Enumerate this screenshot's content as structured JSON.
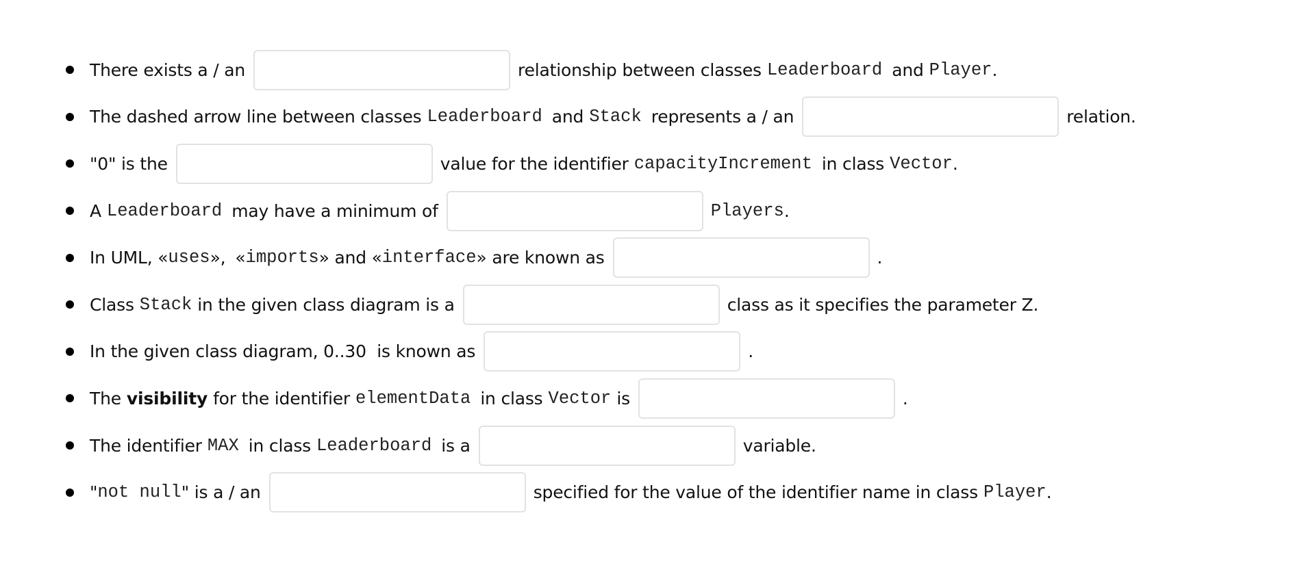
{
  "questions": [
    {
      "parts": {
        "t0": "There exists a / an",
        "t1": "relationship between classes",
        "c1": "Leaderboard",
        "t2": "and",
        "c2": "Player",
        "t3": "."
      },
      "blank": {
        "value": "",
        "placeholder": ""
      }
    },
    {
      "parts": {
        "t0": "The dashed arrow line between classes",
        "c1": "Leaderboard",
        "t1": "and",
        "c2": "Stack",
        "t2": "represents a / an",
        "t3": "relation."
      },
      "blank": {
        "value": "",
        "placeholder": ""
      }
    },
    {
      "parts": {
        "t0": "\"0\" is the",
        "t1": "value for the identifier",
        "c1": "capacityIncrement",
        "t2": "in class",
        "c2": "Vector",
        "t3": "."
      },
      "blank": {
        "value": "",
        "placeholder": ""
      }
    },
    {
      "parts": {
        "t0": "A",
        "c1": "Leaderboard",
        "t1": "may have a minimum of",
        "c2": "Players",
        "t2": "."
      },
      "blank": {
        "value": "",
        "placeholder": ""
      }
    },
    {
      "parts": {
        "t0": "In UML, «",
        "c1": "uses",
        "t1": "»,",
        "t2": "«",
        "c2": "imports",
        "t3": "» and «",
        "c3": "interface",
        "t4": "» are known as",
        "t5": "."
      },
      "blank": {
        "value": "",
        "placeholder": ""
      }
    },
    {
      "parts": {
        "t0": "Class",
        "c1": "Stack",
        "t1": "in the given class diagram is a",
        "t2": "class as it specifies the parameter Z."
      },
      "blank": {
        "value": "",
        "placeholder": ""
      }
    },
    {
      "parts": {
        "t0": "In the given class diagram, 0..30  is known as",
        "t1": "."
      },
      "blank": {
        "value": "",
        "placeholder": ""
      }
    },
    {
      "parts": {
        "t0": "The",
        "b1": "visibility",
        "t1": "for the identifier",
        "c1": "elementData",
        "t2": "in class",
        "c2": "Vector",
        "t3": "is",
        "t4": "."
      },
      "blank": {
        "value": "",
        "placeholder": ""
      }
    },
    {
      "parts": {
        "t0": "The identifier",
        "c1": "MAX",
        "t1": "in class",
        "c2": "Leaderboard",
        "t2": "is a",
        "t3": "variable."
      },
      "blank": {
        "value": "",
        "placeholder": ""
      }
    },
    {
      "parts": {
        "t0": "\"",
        "c1": "not null",
        "t1": "\" is a / an",
        "t2": "specified for the value of the identifier name in class",
        "c2": "Player",
        "t3": "."
      },
      "blank": {
        "value": "",
        "placeholder": ""
      }
    }
  ]
}
